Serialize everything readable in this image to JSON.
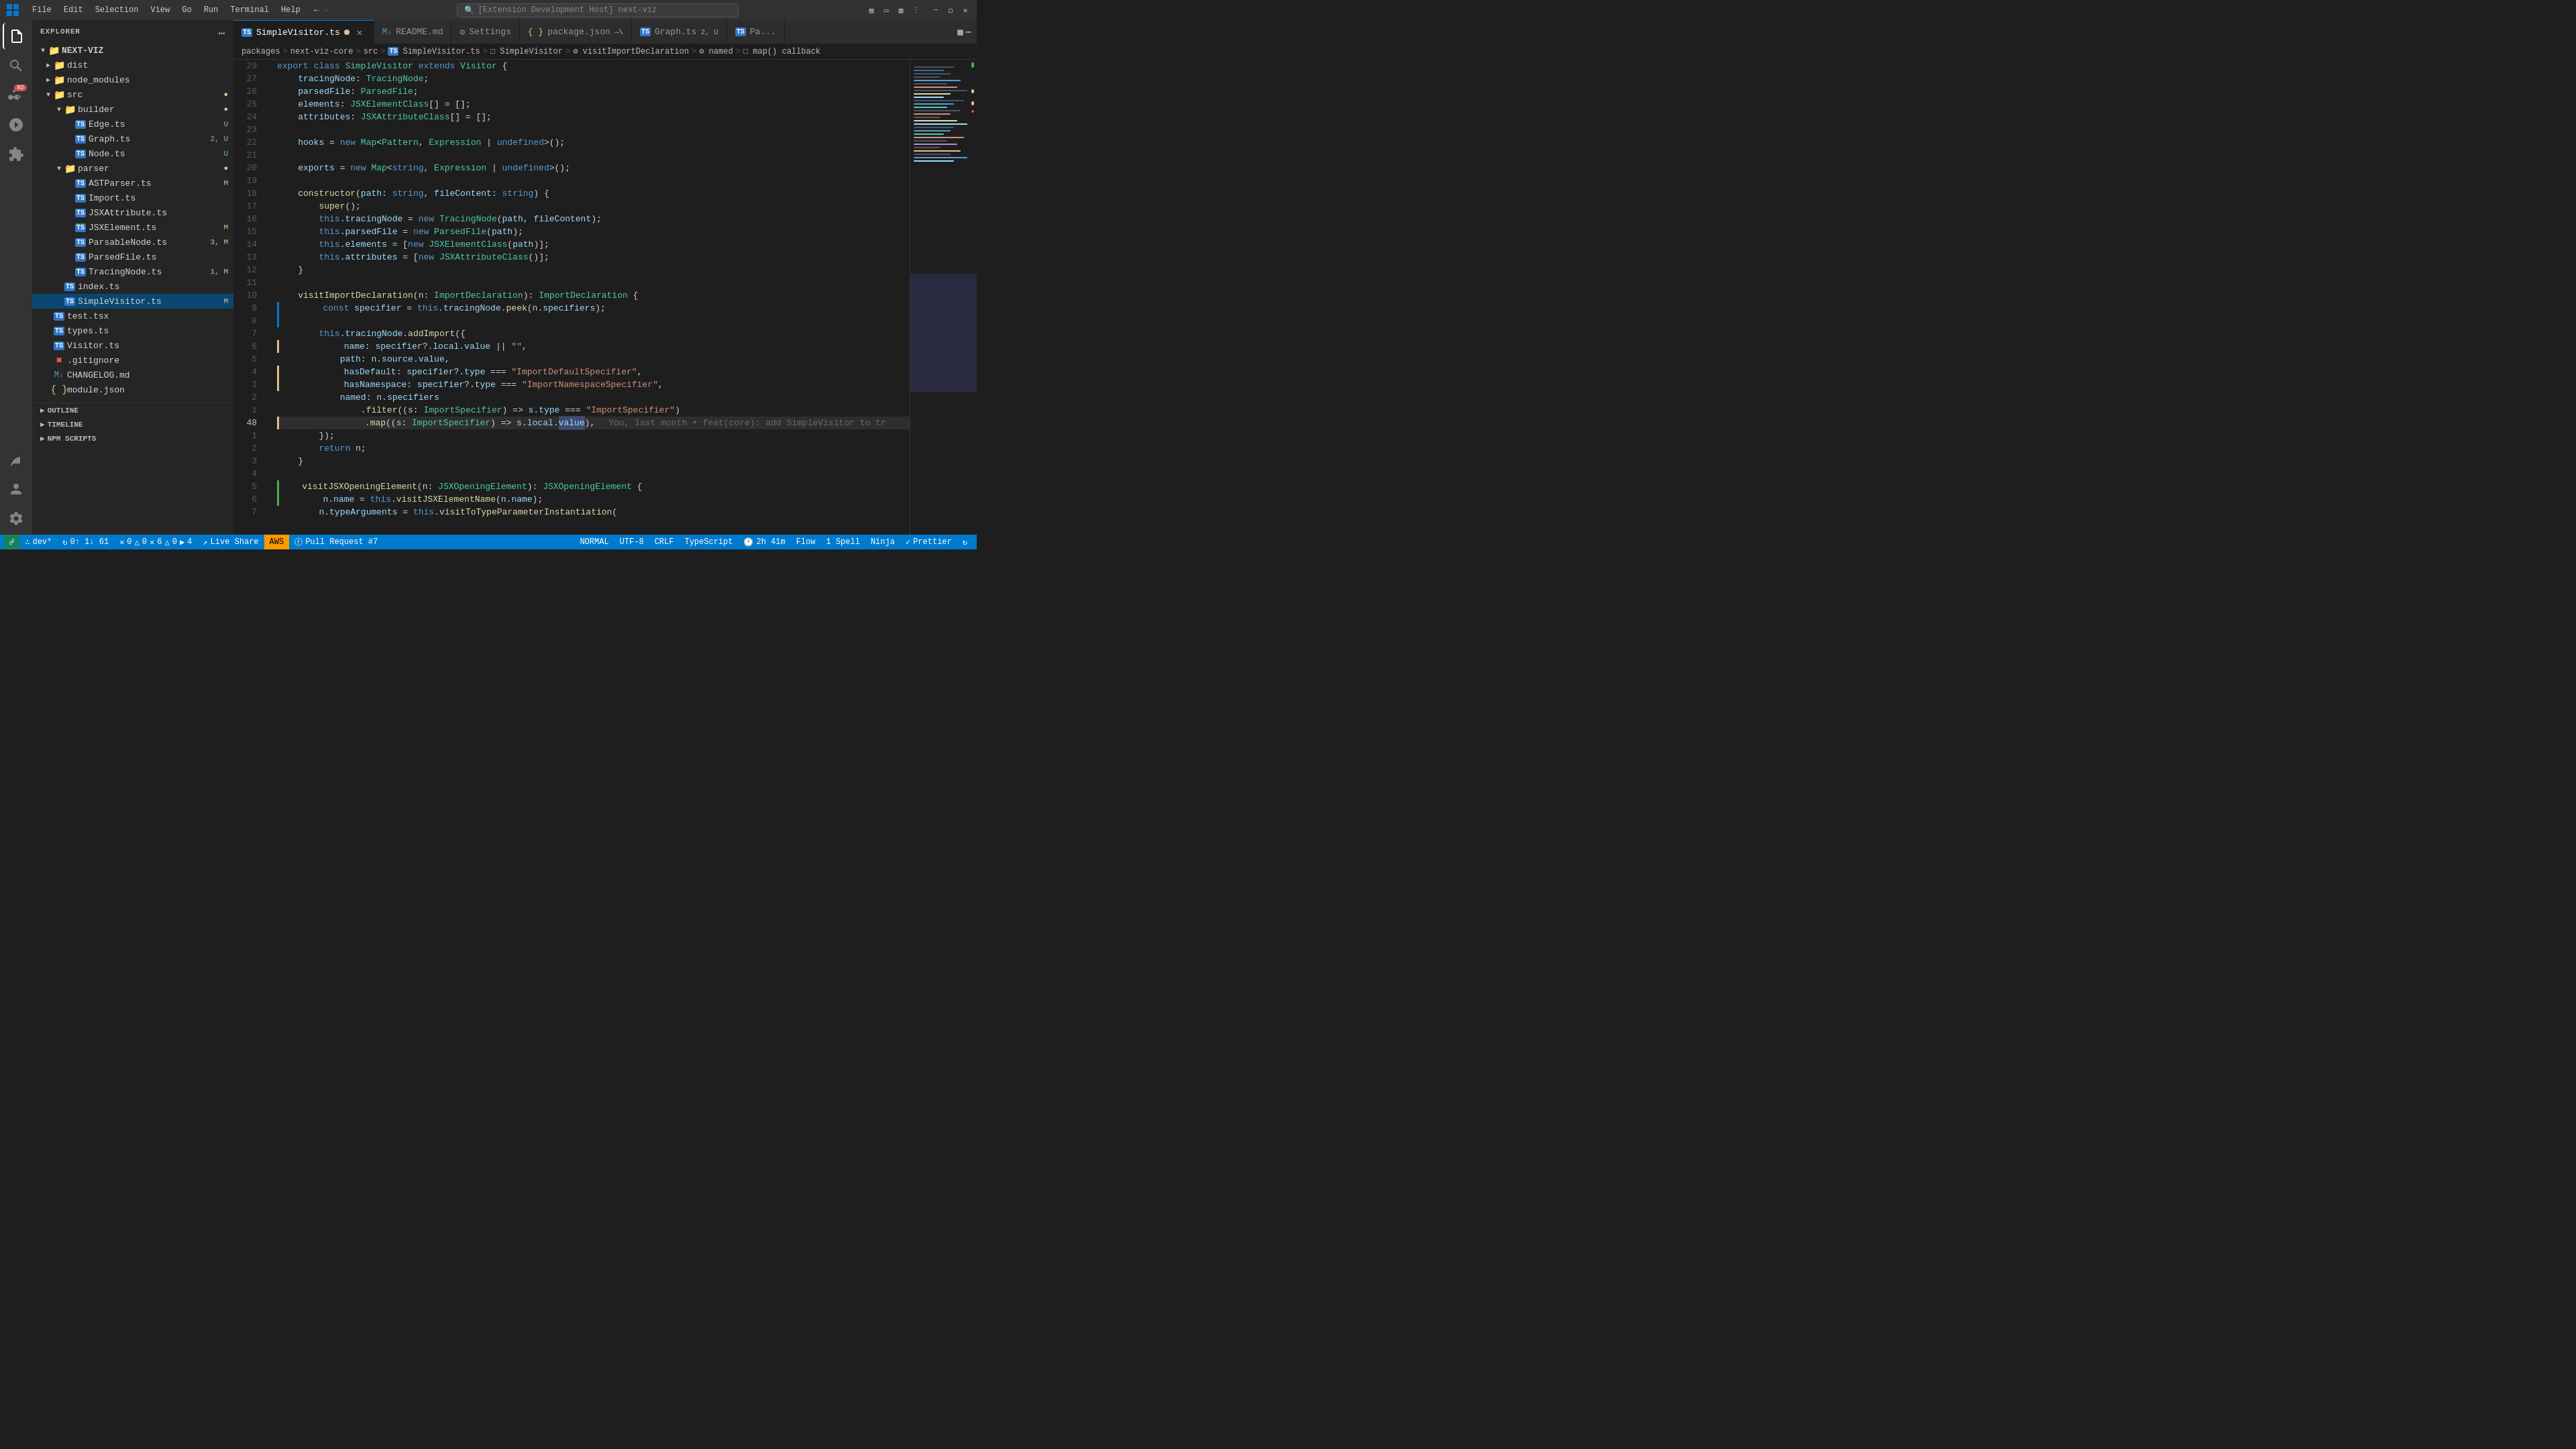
{
  "titlebar": {
    "menu_items": [
      "File",
      "Edit",
      "Selection",
      "View",
      "Go",
      "Run",
      "Terminal",
      "Help"
    ],
    "search_placeholder": "[Extension Development Host] next-viz"
  },
  "sidebar": {
    "header": "EXPLORER",
    "project_name": "NEXT-VIZ",
    "tree": [
      {
        "label": "dist",
        "type": "folder",
        "level": 1,
        "collapsed": true
      },
      {
        "label": "node_modules",
        "type": "folder",
        "level": 1,
        "collapsed": true
      },
      {
        "label": "src",
        "type": "folder",
        "level": 1,
        "collapsed": false,
        "badge": "dot"
      },
      {
        "label": "builder",
        "type": "folder",
        "level": 2,
        "collapsed": false,
        "badge": "dot"
      },
      {
        "label": "Edge.ts",
        "type": "ts",
        "level": 3,
        "badge": "U"
      },
      {
        "label": "Graph.ts",
        "type": "ts",
        "level": 3,
        "badge": "2, U"
      },
      {
        "label": "Node.ts",
        "type": "ts",
        "level": 3,
        "badge": "U"
      },
      {
        "label": "parser",
        "type": "folder",
        "level": 2,
        "collapsed": false,
        "badge": "dot"
      },
      {
        "label": "ASTParser.ts",
        "type": "ts",
        "level": 3,
        "badge": "M"
      },
      {
        "label": "Import.ts",
        "type": "ts",
        "level": 3
      },
      {
        "label": "JSXAttribute.ts",
        "type": "ts",
        "level": 3
      },
      {
        "label": "JSXElement.ts",
        "type": "ts",
        "level": 3,
        "badge": "M"
      },
      {
        "label": "ParsableNode.ts",
        "type": "ts",
        "level": 3,
        "badge": "3, M"
      },
      {
        "label": "ParsedFile.ts",
        "type": "ts",
        "level": 3
      },
      {
        "label": "TracingNode.ts",
        "type": "ts",
        "level": 3,
        "badge": "1, M"
      },
      {
        "label": "index.ts",
        "type": "ts",
        "level": 2
      },
      {
        "label": "SimpleVisitor.ts",
        "type": "ts",
        "level": 2,
        "badge": "M",
        "selected": true
      },
      {
        "label": "test.tsx",
        "type": "ts",
        "level": 1
      },
      {
        "label": "types.ts",
        "type": "ts",
        "level": 1
      },
      {
        "label": "Visitor.ts",
        "type": "ts",
        "level": 1
      },
      {
        "label": ".gitignore",
        "type": "git",
        "level": 1
      },
      {
        "label": "CHANGELOG.md",
        "type": "md",
        "level": 1
      },
      {
        "label": "module.json",
        "type": "json",
        "level": 1
      }
    ],
    "sections": [
      "OUTLINE",
      "TIMELINE",
      "NPM SCRIPTS"
    ]
  },
  "tabs": [
    {
      "label": "SimpleVisitor.ts",
      "type": "ts",
      "active": true,
      "modified": true,
      "closeable": true
    },
    {
      "label": "README.md",
      "type": "md",
      "active": false
    },
    {
      "label": "Settings",
      "type": "settings",
      "active": false
    },
    {
      "label": "package.json",
      "type": "json",
      "active": false
    },
    {
      "label": "Graph.ts",
      "type": "ts",
      "active": false,
      "badge": "2, U"
    },
    {
      "label": "Pa...",
      "type": "ts",
      "active": false
    }
  ],
  "breadcrumb": [
    "packages",
    "next-viz-core",
    "src",
    "SimpleVisitor.ts",
    "SimpleVisitor",
    "visitImportDeclaration",
    "named",
    "map() callback"
  ],
  "code_lines": [
    {
      "num": 29,
      "content": "",
      "gutter": null
    },
    {
      "num": 27,
      "content": "    tracingNode: TracingNode;",
      "gutter": null
    },
    {
      "num": 26,
      "content": "    parsedFile: ParsedFile;",
      "gutter": null
    },
    {
      "num": 25,
      "content": "    elements: JSXElementClass[] = [];",
      "gutter": null
    },
    {
      "num": 24,
      "content": "    attributes: JSXAttributeClass[] = [];",
      "gutter": null
    },
    {
      "num": 23,
      "content": "",
      "gutter": null
    },
    {
      "num": 22,
      "content": "    hooks = new Map<Pattern, Expression | undefined>();",
      "gutter": null
    },
    {
      "num": 21,
      "content": "",
      "gutter": null
    },
    {
      "num": 20,
      "content": "    exports = new Map<string, Expression | undefined>();",
      "gutter": null
    },
    {
      "num": 19,
      "content": "",
      "gutter": null
    },
    {
      "num": 18,
      "content": "    constructor(path: string, fileContent: string) {",
      "gutter": null
    },
    {
      "num": 17,
      "content": "        super();",
      "gutter": null
    },
    {
      "num": 16,
      "content": "        this.tracingNode = new TracingNode(path, fileContent);",
      "gutter": null
    },
    {
      "num": 15,
      "content": "        this.parsedFile = new ParsedFile(path);",
      "gutter": null
    },
    {
      "num": 14,
      "content": "        this.elements = [new JSXElementClass(path)];",
      "gutter": null
    },
    {
      "num": 13,
      "content": "        this.attributes = [new JSXAttributeClass()];",
      "gutter": null
    },
    {
      "num": 12,
      "content": "    }",
      "gutter": null
    },
    {
      "num": 11,
      "content": "",
      "gutter": null
    },
    {
      "num": 10,
      "content": "    visitImportDeclaration(n: ImportDeclaration): ImportDeclaration {",
      "gutter": null
    },
    {
      "num": 9,
      "content": "        const specifier = this.tracingNode.peek(n.specifiers);",
      "gutter": "blue"
    },
    {
      "num": 8,
      "content": "",
      "gutter": "blue"
    },
    {
      "num": 7,
      "content": "        this.tracingNode.addImport({",
      "gutter": null
    },
    {
      "num": 6,
      "content": "            name: specifier?.local.value || \"\",",
      "gutter": "yellow"
    },
    {
      "num": 5,
      "content": "            path: n.source.value,",
      "gutter": null
    },
    {
      "num": 4,
      "content": "            hasDefault: specifier?.type === \"ImportDefaultSpecifier\",",
      "gutter": "yellow"
    },
    {
      "num": 3,
      "content": "            hasNamespace: specifier?.type === \"ImportNamespaceSpecifier\",",
      "gutter": "yellow"
    },
    {
      "num": 2,
      "content": "            named: n.specifiers",
      "gutter": null
    },
    {
      "num": 1,
      "content": "                .filter((s: ImportSpecifier) => s.type === \"ImportSpecifier\")",
      "gutter": null
    },
    {
      "num": 48,
      "content": "                .map((s: ImportSpecifier) => s.local.value),",
      "gutter": "yellow",
      "current": true
    },
    {
      "num": 1,
      "content": "        });",
      "gutter": null
    },
    {
      "num": 2,
      "content": "        return n;",
      "gutter": null
    },
    {
      "num": 3,
      "content": "    }",
      "gutter": null
    },
    {
      "num": 4,
      "content": "",
      "gutter": null
    },
    {
      "num": 5,
      "content": "    visitJSXOpeningElement(n: JSXOpeningElement): JSXOpeningElement {",
      "gutter": "green"
    },
    {
      "num": 6,
      "content": "        n.name = this.visitJSXElementName(n.name);",
      "gutter": "green"
    },
    {
      "num": 7,
      "content": "        n.typeArguments = this.visitToTypeParameterInstantiation(",
      "gutter": null
    }
  ],
  "status_bar": {
    "branch": "dev*",
    "sync": "0↑ 1↓ 61",
    "errors": "0⚠ 0⚡ 6⚠ 0⚡ 4",
    "live_share": "Live Share",
    "aws": "AWS",
    "pull_request": "Pull Request #7",
    "mode": "NORMAL",
    "encoding": "UTF-8",
    "line_ending": "CRLF",
    "language": "TypeScript",
    "time": "2h 41m",
    "flow": "Flow",
    "spell": "1 Spell",
    "ninja": "Ninja",
    "prettier": "Prettier"
  },
  "export_class_line": "export class SimpleVisitor extends Visitor {"
}
